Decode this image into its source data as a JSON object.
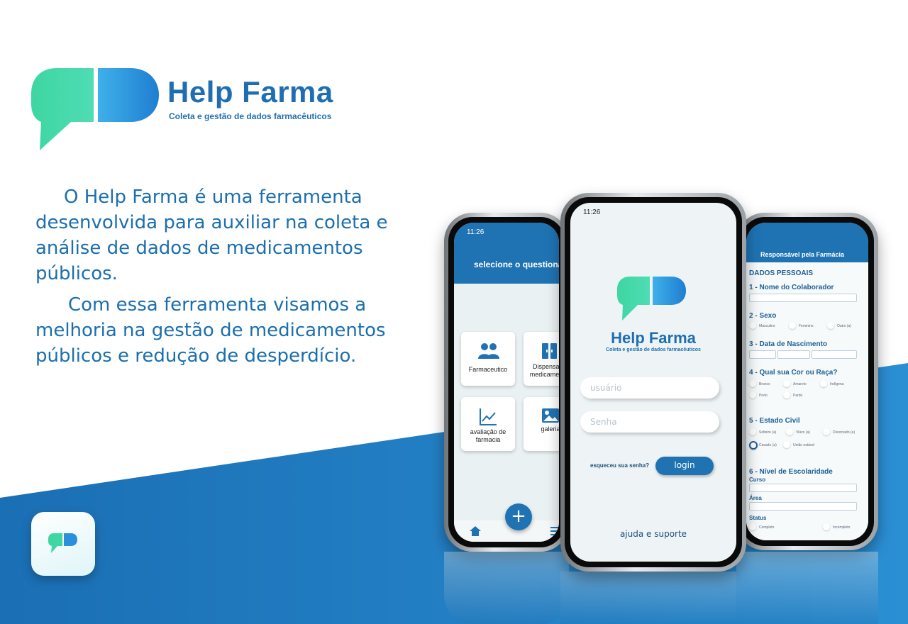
{
  "brand": {
    "name": "Help Farma",
    "tagline": "Coleta e gestão de dados farmacêuticos"
  },
  "intro": {
    "paragraph1": "O Help Farma é uma ferramenta desenvolvida para auxiliar na coleta e análise de dados de medicamentos públicos.",
    "paragraph2": "Com essa ferramenta visamos a melhoria na gestão de medicamentos públicos e redução de desperdício."
  },
  "colors": {
    "primary": "#1f73b3",
    "accent_green": "#4fd6a8",
    "accent_blue": "#3aa0e6"
  },
  "left_phone": {
    "time": "11:26",
    "header_title": "selecione o questionário",
    "cards": [
      {
        "label": "Farmaceutico",
        "icon": "users-icon"
      },
      {
        "label": "Dispensa de medicamentos",
        "icon": "cabinet-icon"
      },
      {
        "label": "avaliação de farmacia",
        "icon": "chart-icon"
      },
      {
        "label": "galeria",
        "icon": "image-icon"
      }
    ],
    "fab_label": "+",
    "nav_icons": [
      "home-icon",
      "menu-icon"
    ]
  },
  "center_phone": {
    "time": "11:26",
    "title": "Help Farma",
    "subtitle": "Coleta e gestão de dados farmacêuticos",
    "username_placeholder": "usuário",
    "password_placeholder": "Senha",
    "forgot_label": "esqueceu sua senha?",
    "login_label": "login",
    "help_label": "ajuda e suporte"
  },
  "right_phone": {
    "header_title": "Responsável pela Farmácia",
    "section_title": "DADOS PESSOAIS",
    "q1": "1 - Nome do Colaborador",
    "q2": "2 - Sexo",
    "q2_options": [
      "Masculino",
      "Feminino",
      "Outro (a)"
    ],
    "q3": "3 - Data de Nascimento",
    "q4": "4 - Qual sua Cor ou Raça?",
    "q4_options": [
      "Branco",
      "Amarelo",
      "Indígena",
      "Preto",
      "Pardo"
    ],
    "q5": "5 - Estado Civil",
    "q5_options": [
      "Solteiro (a)",
      "Viúvo (a)",
      "Divorciado (a)",
      "Casado (a)",
      "União estável"
    ],
    "q6": "6 - Nível de Escolaridade",
    "q6_curso": "Curso",
    "q6_area": "Área",
    "q6_status": "Status",
    "q6_status_options": [
      "Completo",
      "Incompleto"
    ]
  }
}
